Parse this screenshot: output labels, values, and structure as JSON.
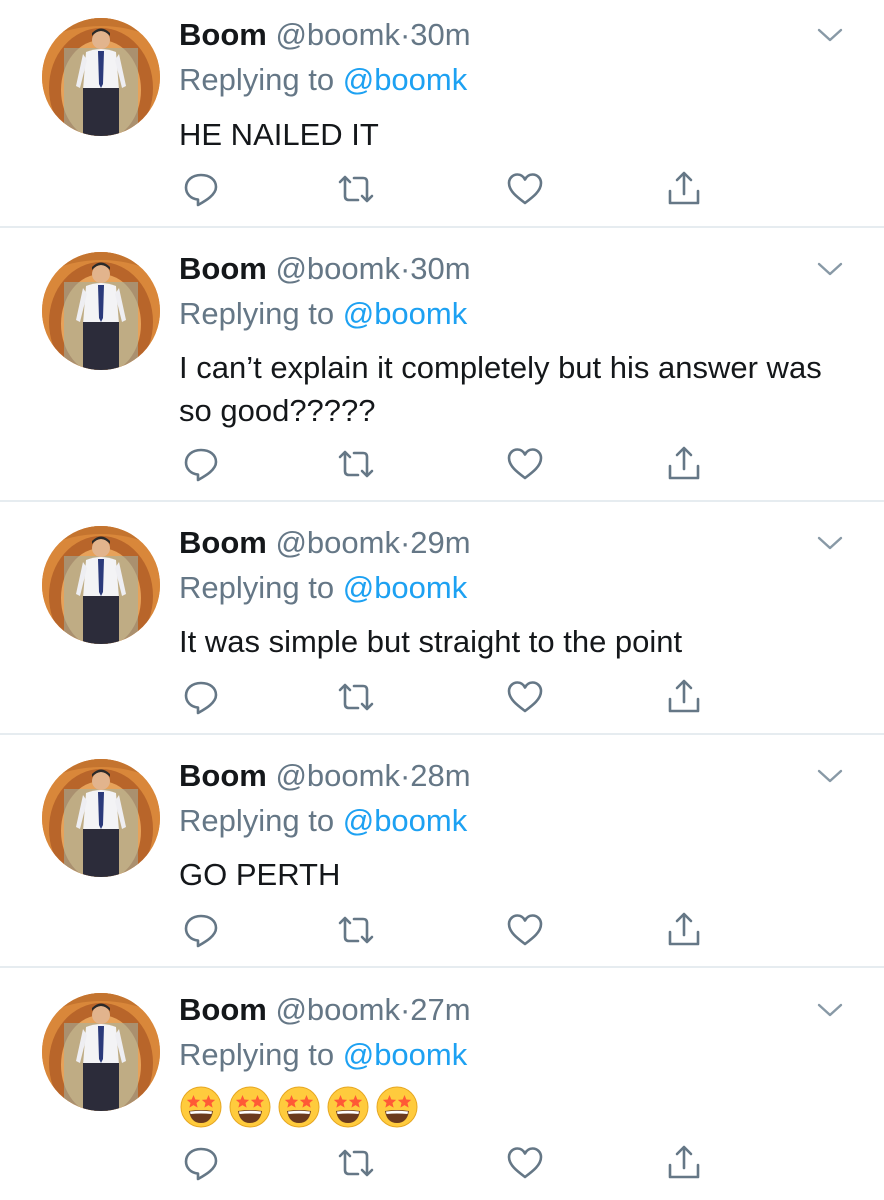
{
  "colors": {
    "primary_text": "#14171a",
    "secondary_text": "#657786",
    "link": "#1da1f2",
    "divider": "#e6ecf0"
  },
  "tweets": [
    {
      "author_name": "Boom",
      "handle": "@boomk",
      "separator": "·",
      "time": "30m",
      "replying_prefix": "Replying to",
      "replying_to": "@boomk",
      "text": "HE NAILED IT"
    },
    {
      "author_name": "Boom",
      "handle": "@boomk",
      "separator": "·",
      "time": "30m",
      "replying_prefix": "Replying to",
      "replying_to": "@boomk",
      "text": "I can’t explain it completely but his answer was so good?????"
    },
    {
      "author_name": "Boom",
      "handle": "@boomk",
      "separator": "·",
      "time": "29m",
      "replying_prefix": "Replying to",
      "replying_to": "@boomk",
      "text": "It was simple but straight to the point"
    },
    {
      "author_name": "Boom",
      "handle": "@boomk",
      "separator": "·",
      "time": "28m",
      "replying_prefix": "Replying to",
      "replying_to": "@boomk",
      "text": "GO PERTH"
    },
    {
      "author_name": "Boom",
      "handle": "@boomk",
      "separator": "·",
      "time": "27m",
      "replying_prefix": "Replying to",
      "replying_to": "@boomk",
      "text": "",
      "emoji": [
        "star-struck-emoji",
        "star-struck-emoji",
        "star-struck-emoji",
        "star-struck-emoji",
        "star-struck-emoji"
      ]
    }
  ],
  "icons": {
    "reply": "reply-icon",
    "retweet": "retweet-icon",
    "like": "like-icon",
    "share": "share-icon",
    "more": "chevron-down-icon",
    "avatar": "avatar"
  }
}
